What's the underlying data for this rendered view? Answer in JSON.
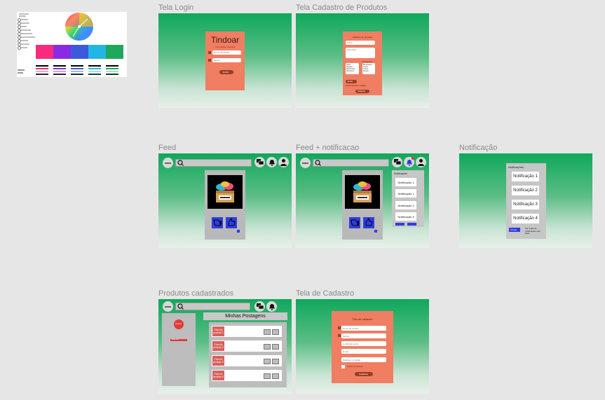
{
  "frames": {
    "login": {
      "label": "Tela Login",
      "brand": "Tindoar",
      "brand_sub": "Compartilhe doações",
      "field1": "Nome do usuário",
      "field2": "Senha",
      "btn": "Entrar"
    },
    "cadastro_produtos": {
      "label": "Tela Cadastro de Produtos",
      "heading": "Cadastro de produtos",
      "field1": "Título",
      "field2": "Descrição",
      "section": "Categorias",
      "list1": [
        "Casa",
        "Roupas",
        "Eletrônicos",
        "Alimentos"
      ],
      "list2": [
        "Brinquedos",
        "Livros",
        "Outros",
        "Móveis"
      ],
      "btn1": "Enviar",
      "note": "Foto do produto + imagem",
      "btn2": "Cadastrar"
    },
    "feed": {
      "label": "Feed"
    },
    "feed_notificacao": {
      "label": "Feed + notificacao",
      "panel_title": "Notificações",
      "items": [
        "Notificação 1",
        "Notificação 1",
        "Notificação 3",
        "Notificação 4"
      ]
    },
    "notificacao": {
      "label": "Notificação",
      "panel_title": "Notificações",
      "items": [
        "Notificação 1",
        "Notificação 2",
        "Notificação 3",
        "Notificação 4"
      ],
      "btn": "Limpar",
      "footer": "Ver todas as notificações não lidas"
    },
    "produtos": {
      "label": "Produtos cadastrados",
      "header": "Minhas Postagens",
      "avatar": "Usuário",
      "profile_btn": "Editar perfil",
      "rows": [
        "Foto do produto 1",
        "Foto do produto 2",
        "Foto do produto 3",
        "Foto do produto 4"
      ]
    },
    "cadastro": {
      "label": "Tela de Cadastro",
      "heading": "Tela de cadastro",
      "fields": [
        "Nome do usuário",
        "Senha",
        "Confirmar senha",
        "Email",
        "Telefone ou celular"
      ],
      "terms": "Aceito os termos",
      "btn": "Cadastrar"
    }
  },
  "colors": {
    "green": "#0fa85b",
    "salmon": "#f07e62",
    "brown": "#9c3e24",
    "blue": "#2f3ee0",
    "swatches": [
      "#f72b7e",
      "#8a2be2",
      "#3b5bdb",
      "#22b6e6",
      "#1ea85c"
    ]
  },
  "icons": [
    "search-icon",
    "chat-icon",
    "bell-icon",
    "user-icon",
    "like-icon",
    "dislike-icon",
    "logo-icon"
  ]
}
